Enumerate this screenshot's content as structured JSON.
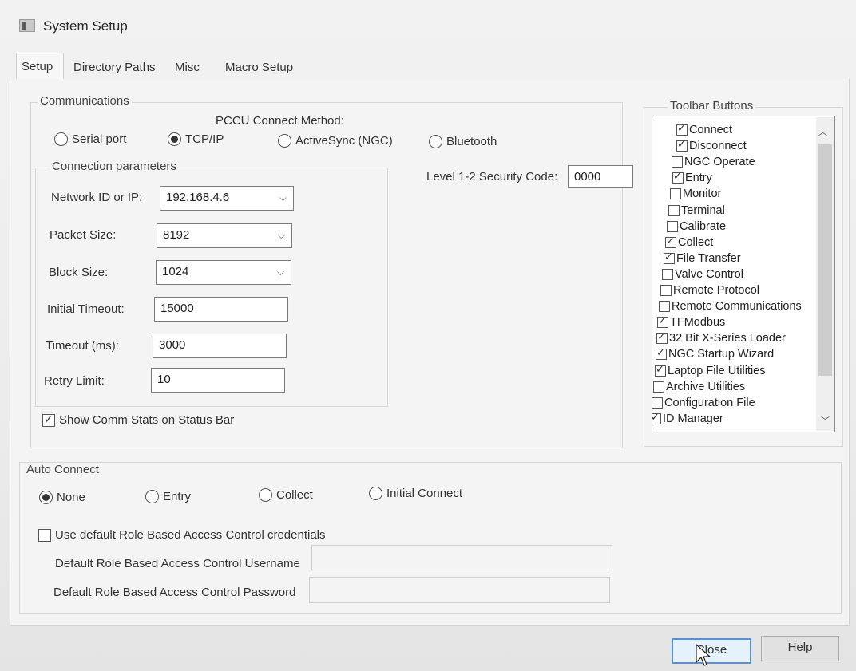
{
  "window": {
    "title": "System Setup",
    "icon": "app-window-icon"
  },
  "tabs": [
    {
      "label": "Setup"
    },
    {
      "label": "Directory Paths"
    },
    {
      "label": "Misc"
    },
    {
      "label": "Macro Setup"
    }
  ],
  "communications": {
    "group_label": "Communications",
    "method_label": "PCCU Connect Method:",
    "methods": [
      {
        "label": "Serial port",
        "selected": false
      },
      {
        "label": "TCP/IP",
        "selected": true
      },
      {
        "label": "ActiveSync (NGC)",
        "selected": false
      },
      {
        "label": "Bluetooth",
        "selected": false
      }
    ],
    "params_label": "Connection parameters",
    "network_id_label": "Network ID or IP:",
    "network_id_value": "192.168.4.6",
    "packet_size_label": "Packet Size:",
    "packet_size_value": "8192",
    "block_size_label": "Block Size:",
    "block_size_value": "1024",
    "initial_timeout_label": "Initial Timeout:",
    "initial_timeout_value": "15000",
    "timeout_label": "Timeout (ms):",
    "timeout_value": "3000",
    "retry_label": "Retry Limit:",
    "retry_value": "10",
    "security_label": "Level 1-2 Security Code:",
    "security_value": "0000",
    "show_stats_label": "Show Comm Stats on Status Bar",
    "show_stats_checked": true
  },
  "toolbar": {
    "group_label": "Toolbar Buttons",
    "items": [
      {
        "label": "Connect",
        "checked": true
      },
      {
        "label": "Disconnect",
        "checked": true
      },
      {
        "label": "NGC Operate",
        "checked": false
      },
      {
        "label": "Entry",
        "checked": true
      },
      {
        "label": "Monitor",
        "checked": false
      },
      {
        "label": "Terminal",
        "checked": false
      },
      {
        "label": "Calibrate",
        "checked": false
      },
      {
        "label": "Collect",
        "checked": true
      },
      {
        "label": "File Transfer",
        "checked": true
      },
      {
        "label": "Valve Control",
        "checked": false
      },
      {
        "label": "Remote Protocol",
        "checked": false
      },
      {
        "label": "Remote Communications",
        "checked": false
      },
      {
        "label": "TFModbus",
        "checked": true
      },
      {
        "label": "32 Bit X-Series Loader",
        "checked": true
      },
      {
        "label": "NGC Startup Wizard",
        "checked": true
      },
      {
        "label": "Laptop File Utilities",
        "checked": true
      },
      {
        "label": "Archive Utilities",
        "checked": false
      },
      {
        "label": "Configuration File",
        "checked": false
      },
      {
        "label": "ID Manager",
        "checked": true
      }
    ]
  },
  "auto_connect": {
    "group_label": "Auto Connect",
    "options": [
      {
        "label": "None",
        "selected": true
      },
      {
        "label": "Entry",
        "selected": false
      },
      {
        "label": "Collect",
        "selected": false
      },
      {
        "label": "Initial Connect",
        "selected": false
      }
    ],
    "rbac_label": "Use default Role Based Access Control credentials",
    "rbac_checked": false,
    "username_label": "Default Role Based Access Control Username",
    "username_value": "",
    "password_label": "Default Role Based Access Control Password",
    "password_value": ""
  },
  "buttons": {
    "close": "Close",
    "help": "Help"
  }
}
